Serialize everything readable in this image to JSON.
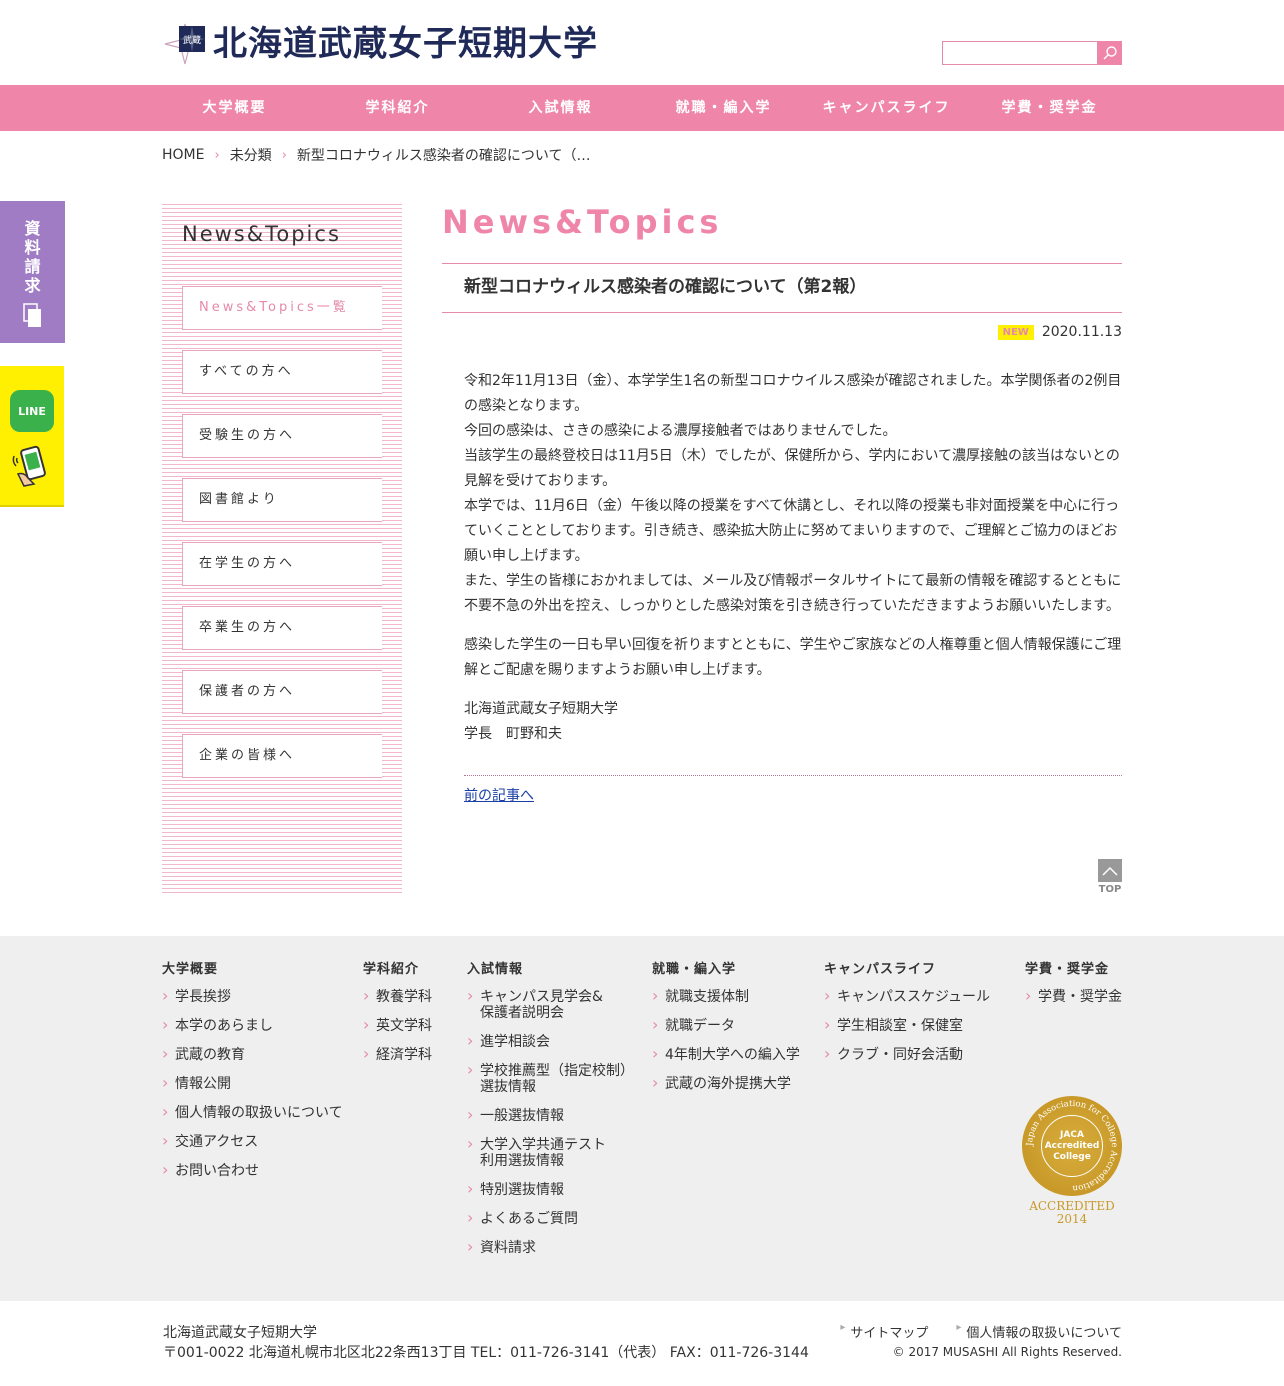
{
  "header": {
    "logo_text": "北海道武蔵女子短期大学",
    "logo_mark_text": "武蔵",
    "search": {
      "placeholder": ""
    }
  },
  "nav": {
    "items": [
      "大学概要",
      "学科紹介",
      "入試情報",
      "就職・編入学",
      "キャンパスライフ",
      "学費・奨学金"
    ]
  },
  "breadcrumb": {
    "items": [
      "HOME",
      "未分類",
      "新型コロナウィルス感染者の確認について（…"
    ]
  },
  "side_buttons": {
    "request_label": [
      "資",
      "料",
      "請",
      "求"
    ],
    "line_label": "LINE"
  },
  "sidebar": {
    "title": "News&Topics",
    "items": [
      "News&Topics一覧",
      "すべての方へ",
      "受験生の方へ",
      "図書館より",
      "在学生の方へ",
      "卒業生の方へ",
      "保護者の方へ",
      "企業の皆様へ"
    ]
  },
  "main": {
    "heading": "News&Topics",
    "post_title": "新型コロナウィルス感染者の確認について（第2報）",
    "badge": "NEW",
    "date": "2020.11.13",
    "paragraph1_lines": [
      "令和2年11月13日（金）、本学学生1名の新型コロナウイルス感染が確認されました。本学関係者の2例目の感染となります。",
      "今回の感染は、さきの感染による濃厚接触者ではありませんでした。",
      "当該学生の最終登校日は11月5日（木）でしたが、保健所から、学内において濃厚接触の該当はないとの見解を受けております。",
      "本学では、11月6日（金）午後以降の授業をすべて休講とし、それ以降の授業も非対面授業を中心に行っていくこととしております。引き続き、感染拡大防止に努めてまいりますので、ご理解とご協力のほどお願い申し上げます。",
      "また、学生の皆様におかれましては、メール及び情報ポータルサイトにて最新の情報を確認するとともに不要不急の外出を控え、しっかりとした感染対策を引き続き行っていただきますようお願いいたします。"
    ],
    "paragraph2": "感染した学生の一日も早い回復を祈りますとともに、学生やご家族などの人権尊重と個人情報保護にご理解とご配慮を賜りますようお願い申し上げます。",
    "signature_org": "北海道武蔵女子短期大学",
    "signature_name": "学長　町野和夫",
    "prev_link": "前の記事へ",
    "top_label": "TOP"
  },
  "footer": {
    "columns": [
      {
        "title": "大学概要",
        "items": [
          "学長挨拶",
          "本学のあらまし",
          "武蔵の教育",
          "情報公開",
          "個人情報の取扱いについて",
          "交通アクセス",
          "お問い合わせ"
        ]
      },
      {
        "title": "学科紹介",
        "items": [
          "教養学科",
          "英文学科",
          "経済学科"
        ]
      },
      {
        "title": "入試情報",
        "items": [
          "キャンパス見学会&\n保護者説明会",
          "進学相談会",
          "学校推薦型（指定校制）\n選抜情報",
          "一般選抜情報",
          "大学入学共通テスト\n利用選抜情報",
          "特別選抜情報",
          "よくあるご質問",
          "資料請求"
        ]
      },
      {
        "title": "就職・編入学",
        "items": [
          "就職支援体制",
          "就職データ",
          "4年制大学への編入学",
          "武蔵の海外提携大学"
        ]
      },
      {
        "title": "キャンパスライフ",
        "items": [
          "キャンパススケジュール",
          "学生相談室・保健室",
          "クラブ・同好会活動"
        ]
      },
      {
        "title": "学費・奨学金",
        "items": [
          "学費・奨学金"
        ]
      }
    ],
    "jaca": {
      "ring_text": "Japan Association for College Accreditation",
      "inner_line1": "JACA",
      "inner_line2": "Accredited",
      "inner_line3": "College",
      "accredited": "ACCREDITED",
      "year": "2014"
    },
    "bottom": {
      "name": "北海道武蔵女子短期大学",
      "address": "〒001-0022 北海道札幌市北区北22条西13丁目  TEL：011-726-3141（代表）    FAX：011-726-3144",
      "links": [
        "サイトマップ",
        "個人情報の取扱いについて"
      ],
      "copyright": "© 2017 MUSASHI All Rights Reserved."
    }
  },
  "colors": {
    "accent_pink": "#ef86a9",
    "navy": "#1f2a58",
    "purple": "#9f7cc4",
    "yellow": "#ffef00",
    "line_green": "#3ab14a",
    "gold": "#c99a29"
  }
}
